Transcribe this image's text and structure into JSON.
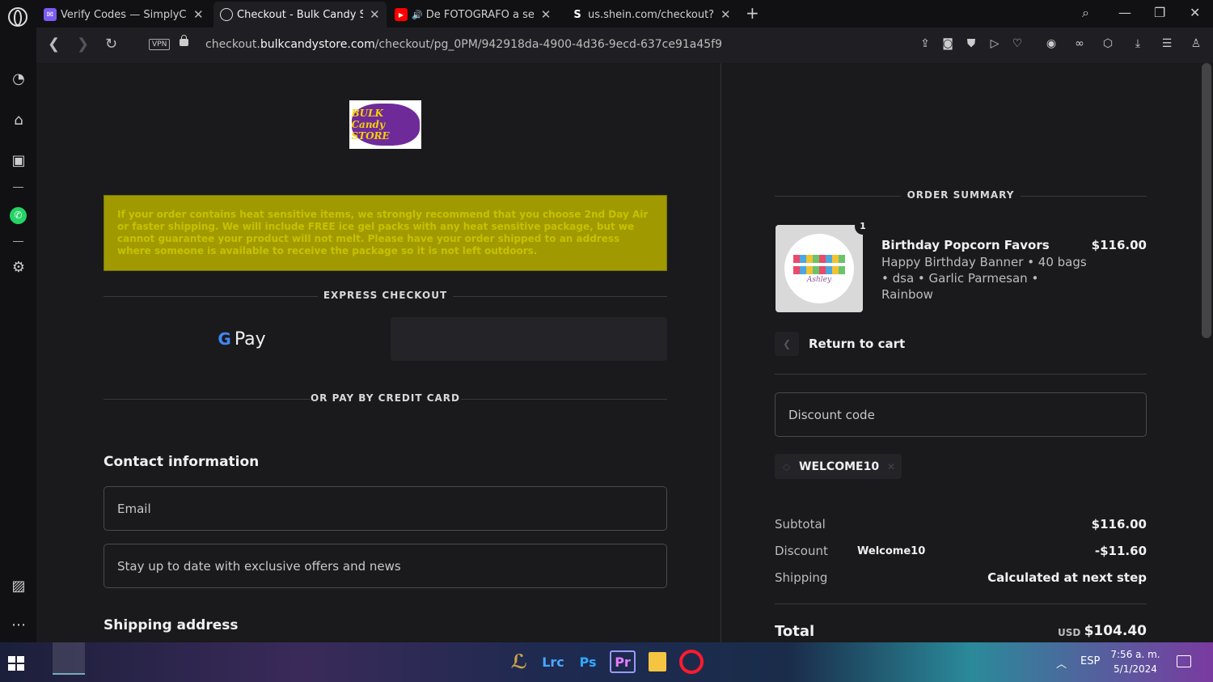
{
  "browser": {
    "tabs": [
      {
        "title": "Verify Codes — SimplyCodes",
        "favicon_color": "#7b5cf0",
        "favicon_glyph": "✉"
      },
      {
        "title": "Checkout - Bulk Candy Store",
        "favicon_color": "#1f1f23",
        "favicon_glyph": "◍"
      },
      {
        "title": "De FOTÓGRAFO a ser TÚ",
        "favicon_color": "#ff0000",
        "favicon_glyph": "▶",
        "audio_icon": "🔊"
      },
      {
        "title": "us.shein.com/checkout?auto",
        "favicon_color": "#111114",
        "favicon_glyph": "S"
      }
    ],
    "url_prefix": "checkout.",
    "url_domain": "bulkcandystore.com",
    "url_path": "/checkout/pg_0PM/942918da-4900-4d36-9ecd-637ce91a45f9",
    "vpn_label": "VPN"
  },
  "page": {
    "notice": "If your order contains heat sensitive items, we strongly recommend that you choose 2nd Day Air or faster shipping. We will include FREE ice gel packs with any heat sensitive package, but we cannot guarantee your product will not melt. Please have your order shipped to an address where someone is available to receive the package so it is not left outdoors.",
    "express_checkout": "EXPRESS CHECKOUT",
    "gpay_label": "Pay",
    "or_credit": "OR PAY BY CREDIT CARD",
    "contact_title": "Contact information",
    "email_placeholder": "Email",
    "offers_placeholder": "Stay up to date with exclusive offers and news",
    "shipping_title": "Shipping address"
  },
  "summary": {
    "title": "ORDER SUMMARY",
    "item": {
      "quantity": "1",
      "name": "Birthday Popcorn Favors",
      "details": "Happy Birthday Banner • 40 bags • dsa • Garlic Parmesan • Rainbow",
      "price": "$116.00",
      "image_name": "Ashley"
    },
    "return_to_cart": "Return to cart",
    "discount_placeholder": "Discount code",
    "applied_code": "WELCOME10",
    "subtotal_label": "Subtotal",
    "subtotal_value": "$116.00",
    "discount_label": "Discount",
    "discount_code": "Welcome10",
    "discount_value": "-$11.60",
    "shipping_label": "Shipping",
    "shipping_value": "Calculated at next step",
    "total_label": "Total",
    "total_currency": "USD",
    "total_value": "$104.40"
  },
  "taskbar": {
    "apps": [
      "Lrc",
      "Ps",
      "Pr"
    ],
    "language": "ESP",
    "time": "7:56 a. m.",
    "date": "5/1/2024"
  }
}
